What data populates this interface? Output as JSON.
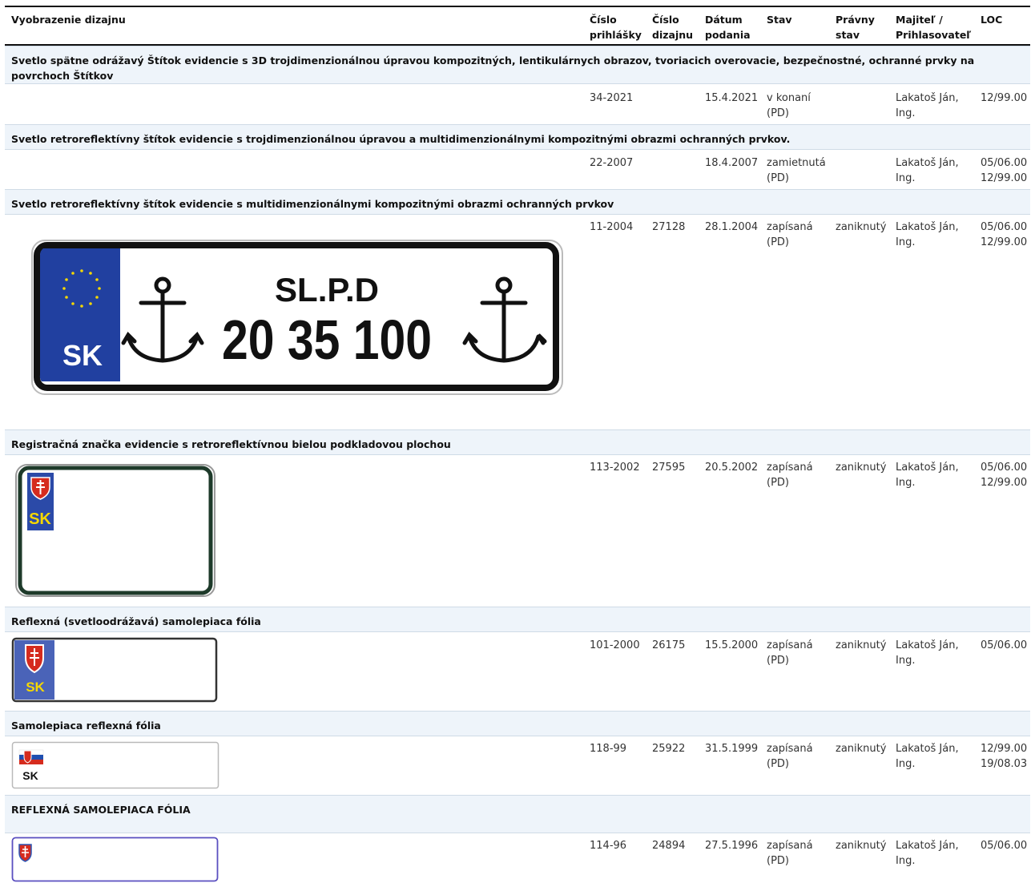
{
  "header": {
    "design_image": "Vyobrazenie dizajnu",
    "application_no_1": "Číslo",
    "application_no_2": "prihlášky",
    "design_no_1": "Číslo",
    "design_no_2": "dizajnu",
    "filing_date_1": "Dátum",
    "filing_date_2": "podania",
    "status": "Stav",
    "legal_status_1": "Právny",
    "legal_status_2": "stav",
    "owner_1": "Majiteľ /",
    "owner_2": "Prihlasovateľ",
    "loc": "LOC"
  },
  "rows": [
    {
      "title": "Svetlo spätne odrážavý Štítok evidencie s 3D trojdimenzionálnou úpravou kompozitných, lentikulárnych obrazov, tvoriacich overovacie, bezpečnostné, ochranné prvky na povrchoch Štítkov",
      "app_no": "34-2021",
      "design_no": "",
      "date": "15.4.2021",
      "status_1": "v konaní",
      "status_2": "(PD)",
      "legal": "",
      "owner_1": "Lakatoš Ján,",
      "owner_2": "Ing.",
      "loc_1": "12/99.00",
      "loc_2": ""
    },
    {
      "title": "Svetlo retroreflektívny štítok evidencie s trojdimenzionálnou úpravou a multidimenzionálnymi kompozitnými obrazmi ochranných prvkov.",
      "app_no": "22-2007",
      "design_no": "",
      "date": "18.4.2007",
      "status_1": "zamietnutá",
      "status_2": "(PD)",
      "legal": "",
      "owner_1": "Lakatoš Ján,",
      "owner_2": "Ing.",
      "loc_1": "05/06.00",
      "loc_2": "12/99.00"
    },
    {
      "title": "Svetlo retroreflektívny štítok evidencie s multidimenzionálnymi kompozitnými obrazmi ochranných prvkov",
      "app_no": "11-2004",
      "design_no": "27128",
      "date": "28.1.2004",
      "status_1": "zapísaná",
      "status_2": "(PD)",
      "legal": "zaniknutý",
      "owner_1": "Lakatoš Ján,",
      "owner_2": "Ing.",
      "loc_1": "05/06.00",
      "loc_2": "12/99.00"
    },
    {
      "title": "Registračná značka evidencie s retroreflektívnou bielou podkladovou plochou",
      "app_no": "113-2002",
      "design_no": "27595",
      "date": "20.5.2002",
      "status_1": "zapísaná",
      "status_2": "(PD)",
      "legal": "zaniknutý",
      "owner_1": "Lakatoš Ján,",
      "owner_2": "Ing.",
      "loc_1": "05/06.00",
      "loc_2": "12/99.00"
    },
    {
      "title": "Reflexná (svetloodrážavá) samolepiaca fólia",
      "app_no": "101-2000",
      "design_no": "26175",
      "date": "15.5.2000",
      "status_1": "zapísaná",
      "status_2": "(PD)",
      "legal": "zaniknutý",
      "owner_1": "Lakatoš Ján,",
      "owner_2": "Ing.",
      "loc_1": "05/06.00",
      "loc_2": ""
    },
    {
      "title": "Samolepiaca reflexná fólia",
      "app_no": "118-99",
      "design_no": "25922",
      "date": "31.5.1999",
      "status_1": "zapísaná",
      "status_2": "(PD)",
      "legal": "zaniknutý",
      "owner_1": "Lakatoš Ján,",
      "owner_2": "Ing.",
      "loc_1": "12/99.00",
      "loc_2": "19/08.03"
    },
    {
      "title": "REFLEXNÁ SAMOLEPIACA FÓLIA",
      "app_no": "114-96",
      "design_no": "24894",
      "date": "27.5.1996",
      "status_1": "zapísaná",
      "status_2": "(PD)",
      "legal": "zaniknutý",
      "owner_1": "Lakatoš Ján,",
      "owner_2": "Ing.",
      "loc_1": "05/06.00",
      "loc_2": ""
    }
  ],
  "plates": {
    "plate1_line1": "SL.P.D",
    "plate1_line2": "20 35 100",
    "plate1_country": "SK",
    "plate2_country": "SK",
    "plate3_country": "SK",
    "plate4_country": "SK"
  },
  "colors": {
    "band_bg": "#eef4fa",
    "eu_blue": "#2140a0",
    "eu_yellow": "#f5d800",
    "sk_red": "#d52b1e"
  }
}
